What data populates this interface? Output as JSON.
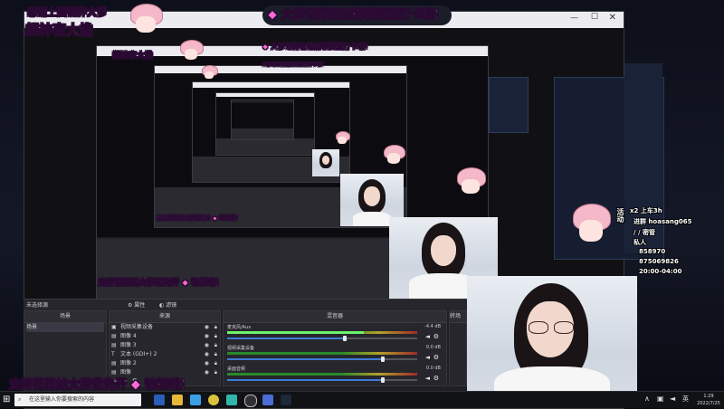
{
  "banners": {
    "top_main": "大爹记得在钻粉联赛里打卡哦！",
    "top_left_line1": "感谢上图钢养大爹",
    "top_left_line2": "超神夜大撸",
    "mid_left": "支持花花的大爹优先开",
    "mid_left_2": "钻粉哦！",
    "bottom_left": "支持花花的大爹优先开",
    "bottom_left_2": "钻粉哦！"
  },
  "window": {
    "title": ""
  },
  "obs": {
    "no_source_label": "未选择源",
    "props_button": "属性",
    "filters_button": "滤镜",
    "scenes_header": "场景",
    "sources_header": "来源",
    "mixer_header": "混音器",
    "transition_header": "转场",
    "scenes": [
      {
        "label": "场景"
      }
    ],
    "sources": [
      {
        "label": "视频采集设备"
      },
      {
        "label": "图像 4"
      },
      {
        "label": "图像 3"
      },
      {
        "label": "文本 (GDI+) 2"
      },
      {
        "label": "图像 2"
      },
      {
        "label": "图像"
      }
    ],
    "mixer": [
      {
        "name": "麦克风/Aux",
        "db": "-4.4 dB",
        "level": 0.72,
        "volume": 0.62
      },
      {
        "name": "视频采集设备",
        "db": "0.0 dB",
        "level": 0.0,
        "volume": 0.82
      },
      {
        "name": "桌面音频",
        "db": "0.0 dB",
        "level": 0.0,
        "volume": 0.82
      }
    ]
  },
  "chat": {
    "lines": [
      {
        "text": "x2 上车3h"
      },
      {
        "text": "进群 hoasang065"
      },
      {
        "text": "/ / 密管"
      },
      {
        "text": "私人"
      },
      {
        "text": "858970"
      },
      {
        "text": "875069826"
      },
      {
        "text": "20:00-04:00"
      }
    ],
    "side_label": "活动"
  },
  "taskbar": {
    "search_placeholder": "在这里输入你要搜索的内容",
    "clock_time": "1:29",
    "clock_date": "2022/7/25",
    "ime": "英"
  },
  "colors": {
    "banner_yellow": "#ffe34d",
    "banner_outline": "#2a0a33",
    "obs_bg": "#1f1f23",
    "meter_green": "#6cf26c",
    "slider_blue": "#3e7bd6"
  }
}
